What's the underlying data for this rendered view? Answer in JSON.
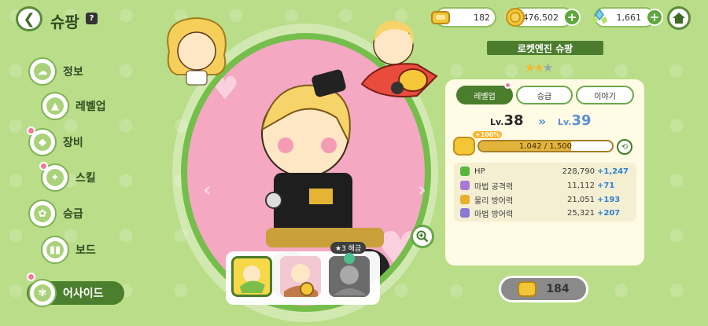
{
  "header": {
    "title": "슈팡",
    "help_label": "?"
  },
  "resources": [
    {
      "name": "gold-bar",
      "value": "182"
    },
    {
      "name": "coin",
      "value": "476,502"
    },
    {
      "name": "crystal",
      "value": "1,661"
    }
  ],
  "sidebar": {
    "items": [
      {
        "label": "정보"
      },
      {
        "label": "레벨업"
      },
      {
        "label": "장비"
      },
      {
        "label": "스킬"
      },
      {
        "label": "승급"
      },
      {
        "label": "보드"
      },
      {
        "label": "어사이드"
      }
    ]
  },
  "cookie": {
    "name": "로켓엔진 슈팡",
    "stars": 2,
    "max_stars": 3
  },
  "tabs": [
    {
      "label": "레벨업"
    },
    {
      "label": "승급"
    },
    {
      "label": "이야기"
    }
  ],
  "level": {
    "prefix": "Lv.",
    "current": "38",
    "next": "39"
  },
  "xp": {
    "bonus": "+100%",
    "text": "1,042 / 1,500",
    "fraction": 0.6947
  },
  "stats": [
    {
      "name": "HP",
      "value": "228,790",
      "bonus": "+1,247",
      "color": "#5bb53c"
    },
    {
      "name": "마법 공격력",
      "value": "11,112",
      "bonus": "+71",
      "color": "#a87ad6"
    },
    {
      "name": "물리 방어력",
      "value": "21,051",
      "bonus": "+193",
      "color": "#e8b02d"
    },
    {
      "name": "마법 방어력",
      "value": "25,321",
      "bonus": "+207",
      "color": "#8a78d4"
    }
  ],
  "skins": {
    "unlock_label": "★3 해금"
  },
  "action": {
    "cost": "184"
  },
  "colors": {
    "accent": "#4a7d2c",
    "bonus_text": "#2f7fd0",
    "stage": "#f4a8c2"
  }
}
